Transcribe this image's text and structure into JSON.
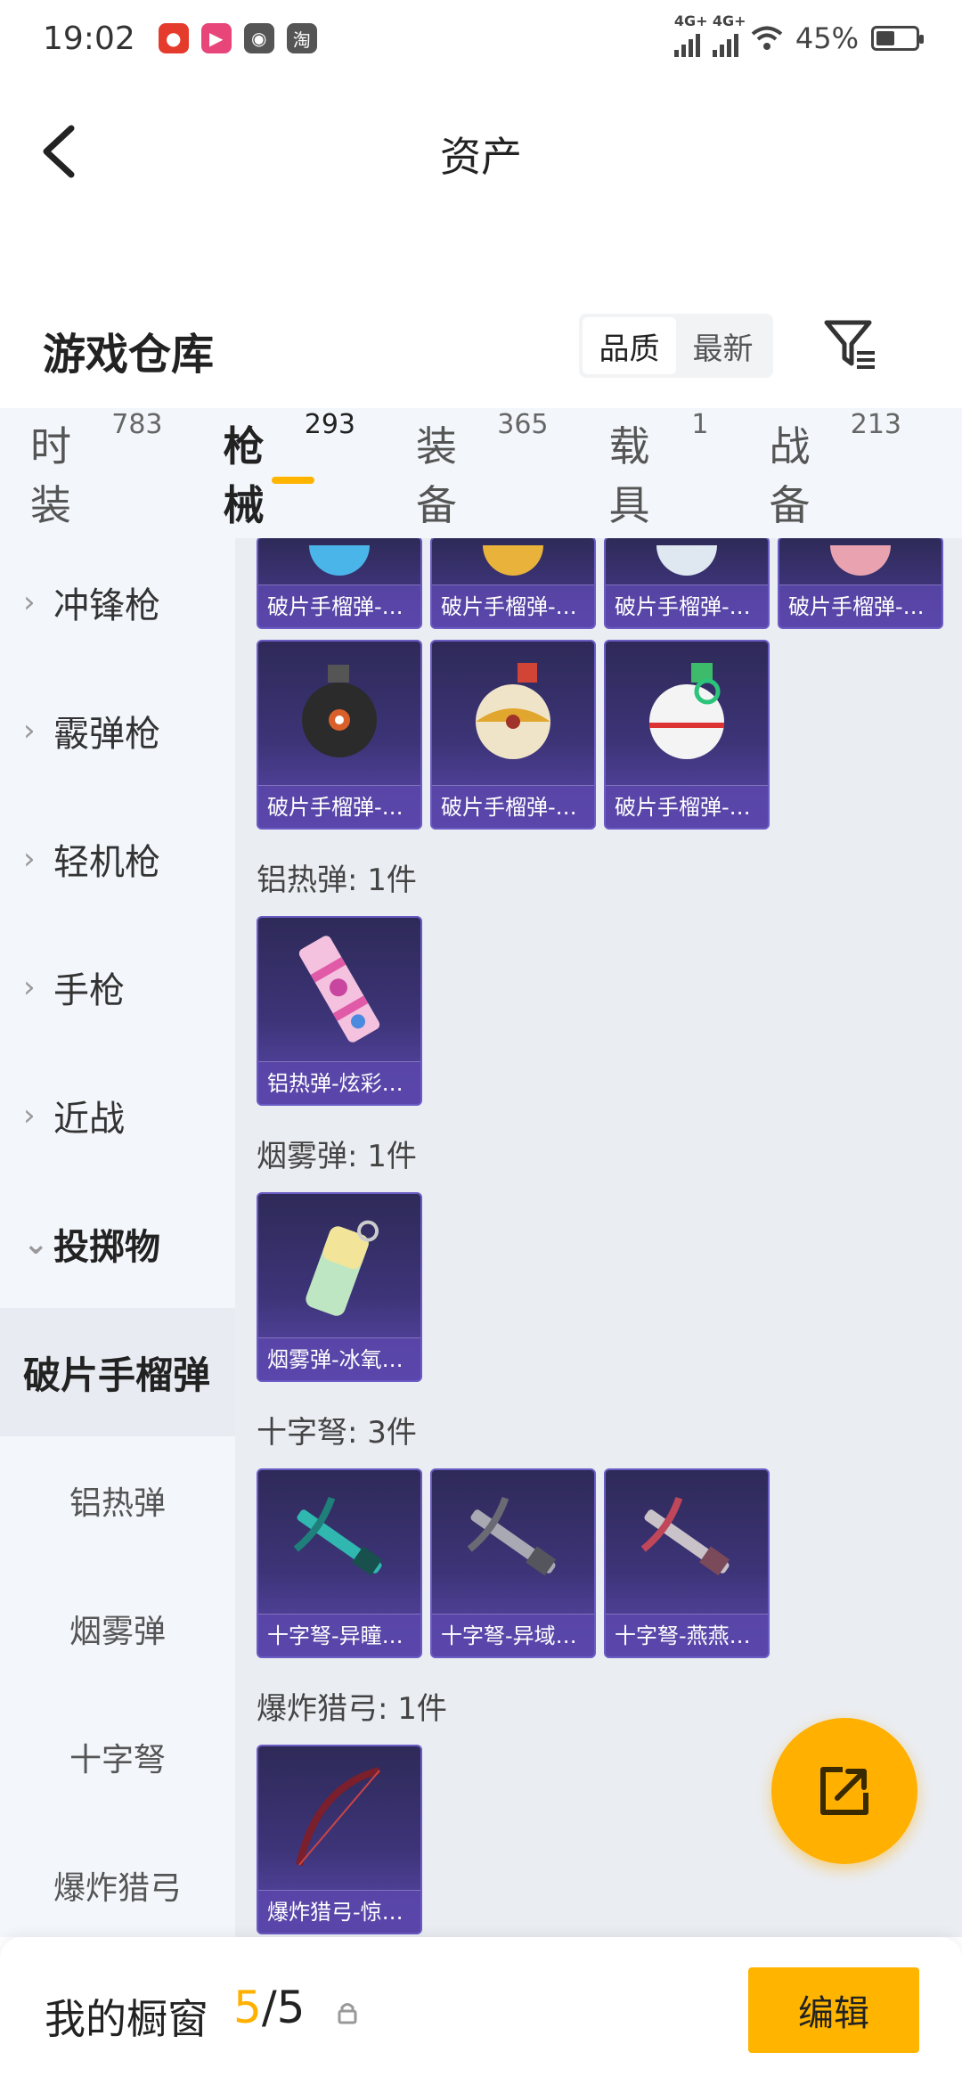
{
  "status_bar": {
    "time": "19:02",
    "net1": "4G+",
    "net2": "4G+",
    "battery": "45%"
  },
  "header": {
    "title": "资产"
  },
  "warehouse": {
    "title": "游戏仓库",
    "sort_quality": "品质",
    "sort_newest": "最新"
  },
  "tabs": [
    {
      "label": "时装",
      "count": "783"
    },
    {
      "label": "枪械",
      "count": "293"
    },
    {
      "label": "装备",
      "count": "365"
    },
    {
      "label": "载具",
      "count": "1"
    },
    {
      "label": "战备",
      "count": "213"
    }
  ],
  "sidebar": {
    "items": [
      {
        "label": "冲锋枪"
      },
      {
        "label": "霰弹枪"
      },
      {
        "label": "轻机枪"
      },
      {
        "label": "手枪"
      },
      {
        "label": "近战"
      },
      {
        "label": "投掷物"
      },
      {
        "label": "破片手榴弹"
      },
      {
        "label": "铝热弹"
      },
      {
        "label": "烟雾弹"
      },
      {
        "label": "十字弩"
      },
      {
        "label": "爆炸猎弓"
      }
    ]
  },
  "content": {
    "top_row": [
      "破片手榴弹-…",
      "破片手榴弹-…",
      "破片手榴弹-…",
      "破片手榴弹-…"
    ],
    "grenade_row": [
      "破片手榴弹-…",
      "破片手榴弹-…",
      "破片手榴弹-…"
    ],
    "thermite": {
      "label": "铝热弹: 1件",
      "items": [
        "铝热弹-炫彩…"
      ]
    },
    "smoke": {
      "label": "烟雾弹: 1件",
      "items": [
        "烟雾弹-冰氧…"
      ]
    },
    "crossbow": {
      "label": "十字弩: 3件",
      "items": [
        "十字弩-异瞳…",
        "十字弩-异域…",
        "十字弩-燕燕…"
      ]
    },
    "bow": {
      "label": "爆炸猎弓: 1件",
      "items": [
        "爆炸猎弓-惊…"
      ]
    }
  },
  "bottom_bar": {
    "title": "我的橱窗",
    "count_current": "5",
    "count_total": "/5",
    "edit_label": "编辑"
  },
  "colors": {
    "accent": "#ffb400",
    "card": "#3d3478",
    "sidebar_bg": "#f3f6fb"
  }
}
